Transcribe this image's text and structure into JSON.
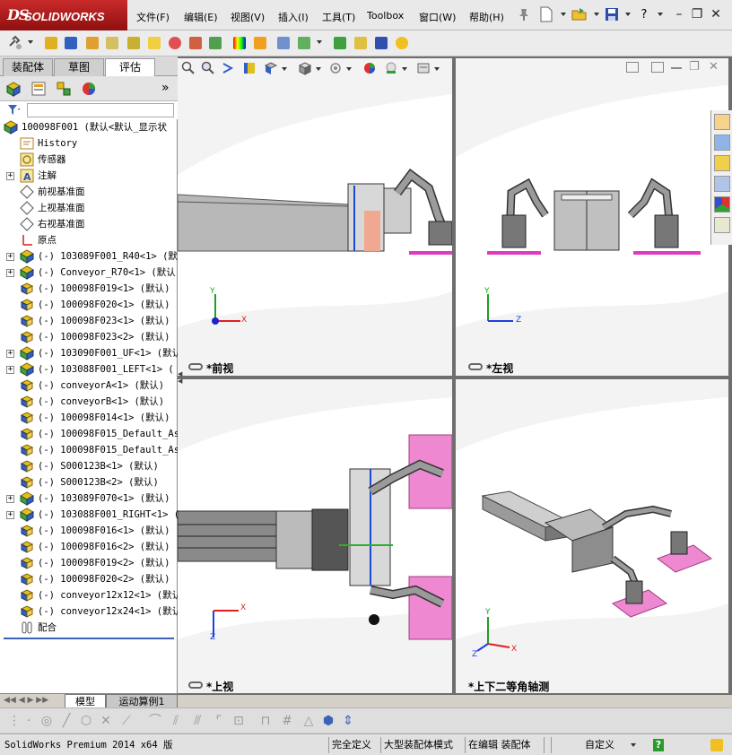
{
  "app": {
    "logo": "SOLIDWORKS",
    "logo_ds": "DS"
  },
  "menu": {
    "items": [
      "文件(F)",
      "编辑(E)",
      "视图(V)",
      "插入(I)",
      "工具(T)",
      "Toolbox",
      "窗口(W)",
      "帮助(H)"
    ]
  },
  "panel": {
    "tabs": [
      "装配体",
      "草图",
      "评估"
    ],
    "active_tab": "评估",
    "expand_arrow": "»"
  },
  "tree": {
    "root": "100098F001  (默认<默认_显示状",
    "items": [
      {
        "label": "History",
        "icon": "history-icon",
        "expand": false
      },
      {
        "label": "传感器",
        "icon": "sensor-icon",
        "expand": false
      },
      {
        "label": "注解",
        "icon": "annotation-icon",
        "expand": true
      },
      {
        "label": "前视基准面",
        "icon": "plane-icon",
        "expand": false
      },
      {
        "label": "上视基准面",
        "icon": "plane-icon",
        "expand": false
      },
      {
        "label": "右视基准面",
        "icon": "plane-icon",
        "expand": false
      },
      {
        "label": "原点",
        "icon": "origin-icon",
        "expand": false
      },
      {
        "label": "(-) 103089F001_R40<1> (默",
        "icon": "subassembly-icon",
        "expand": true
      },
      {
        "label": "(-) Conveyor_R70<1> (默认",
        "icon": "subassembly-icon",
        "expand": true
      },
      {
        "label": "(-) 100098F019<1> (默认)",
        "icon": "part-icon",
        "expand": false
      },
      {
        "label": "(-) 100098F020<1> (默认)",
        "icon": "part-icon",
        "expand": false
      },
      {
        "label": "(-) 100098F023<1> (默认)",
        "icon": "part-icon",
        "expand": false
      },
      {
        "label": "(-) 100098F023<2> (默认)",
        "icon": "part-icon",
        "expand": false
      },
      {
        "label": "(-) 103090F001_UF<1> (默认",
        "icon": "subassembly-icon",
        "expand": true
      },
      {
        "label": "(-) 103088F001_LEFT<1> (",
        "icon": "subassembly-icon",
        "expand": true
      },
      {
        "label": "(-) conveyorA<1> (默认)",
        "icon": "part-icon",
        "expand": false
      },
      {
        "label": "(-) conveyorB<1> (默认)",
        "icon": "part-icon",
        "expand": false
      },
      {
        "label": "(-) 100098F014<1> (默认)",
        "icon": "part-icon",
        "expand": false
      },
      {
        "label": "(-) 100098F015_Default_As",
        "icon": "part-icon",
        "expand": false
      },
      {
        "label": "(-) 100098F015_Default_As",
        "icon": "part-icon",
        "expand": false
      },
      {
        "label": "(-) S000123B<1> (默认)",
        "icon": "part-icon",
        "expand": false
      },
      {
        "label": "(-) S000123B<2> (默认)",
        "icon": "part-icon",
        "expand": false
      },
      {
        "label": "(-) 103089F070<1> (默认)",
        "icon": "subassembly-icon",
        "expand": true
      },
      {
        "label": "(-) 103088F001_RIGHT<1> (",
        "icon": "subassembly-icon",
        "expand": true
      },
      {
        "label": "(-) 100098F016<1> (默认)",
        "icon": "part-icon",
        "expand": false
      },
      {
        "label": "(-) 100098F016<2> (默认)",
        "icon": "part-icon",
        "expand": false
      },
      {
        "label": "(-) 100098F019<2> (默认)",
        "icon": "part-icon",
        "expand": false
      },
      {
        "label": "(-) 100098F020<2> (默认)",
        "icon": "part-icon",
        "expand": false
      },
      {
        "label": "(-) conveyor12x12<1> (默认",
        "icon": "part-icon",
        "expand": false
      },
      {
        "label": "(-) conveyor12x24<1> (默认",
        "icon": "part-icon",
        "expand": false
      },
      {
        "label": "配合",
        "icon": "mates-icon",
        "expand": false
      }
    ]
  },
  "bottom_tabs": [
    "模型",
    "运动算例1"
  ],
  "viewports": {
    "front": {
      "label": "*前视",
      "axes": [
        "Y",
        "X"
      ]
    },
    "left": {
      "label": "*左视",
      "axes": [
        "Y",
        "Z"
      ]
    },
    "top": {
      "label": "*上视",
      "axes": [
        "X",
        "Z"
      ]
    },
    "iso": {
      "label": "*上下二等角轴测",
      "axes": [
        "Y",
        "X",
        "Z"
      ]
    }
  },
  "status": {
    "product": "SolidWorks Premium 2014 x64 版",
    "fully_defined": "完全定义",
    "large_assembly": "大型装配体模式",
    "editing": "在编辑 装配体",
    "custom": "自定义",
    "help_icon": "?"
  },
  "colors": {
    "logo_red": "#c0201e",
    "accent_blue": "#3b62b5",
    "pink_pad": "#ee88d0"
  }
}
